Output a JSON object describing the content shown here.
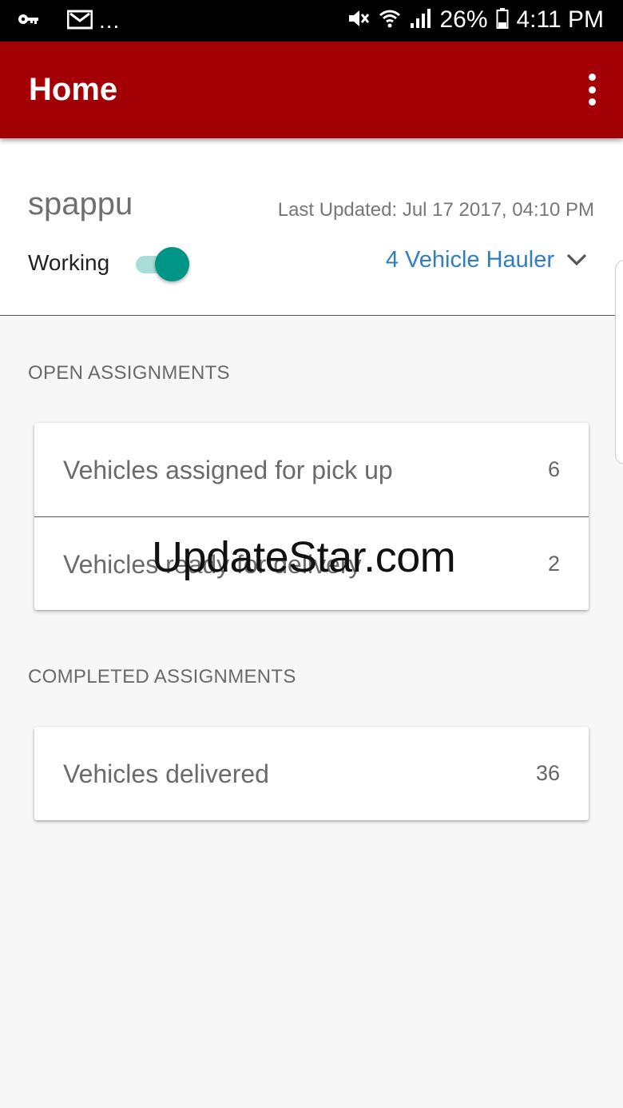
{
  "status_bar": {
    "battery": "26%",
    "time": "4:11 PM",
    "more": "...",
    "icons": [
      "key-icon",
      "gmail-icon",
      "mute-icon",
      "wifi-icon",
      "signal-icon",
      "battery-icon"
    ]
  },
  "app_bar": {
    "title": "Home",
    "background": "#a30006"
  },
  "header": {
    "username": "spappu",
    "last_updated": "Last Updated: Jul 17 2017, 04:10 PM",
    "working_label": "Working",
    "working_toggle_on": true,
    "vehicle_type": "4 Vehicle Hauler",
    "accent": "#009587",
    "link_color": "#2f7ec1"
  },
  "open_assignments": {
    "title": "OPEN ASSIGNMENTS",
    "rows": [
      {
        "label": "Vehicles assigned for pick up",
        "count": "6"
      },
      {
        "label": "Vehicles ready for delivery",
        "count": "2"
      }
    ]
  },
  "completed_assignments": {
    "title": "COMPLETED ASSIGNMENTS",
    "rows": [
      {
        "label": "Vehicles delivered",
        "count": "36"
      }
    ]
  },
  "watermark": "UpdateStar.com"
}
